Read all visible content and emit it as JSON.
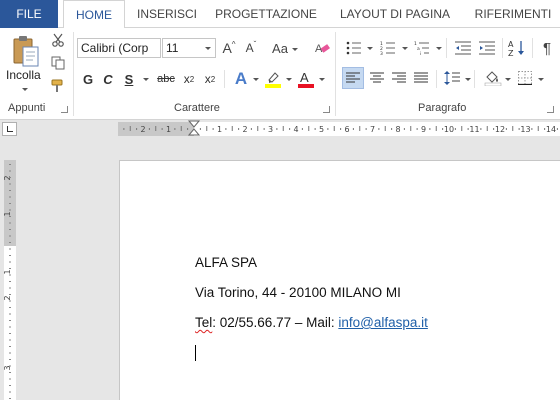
{
  "tabs": {
    "file": "FILE",
    "home": "HOME",
    "insert": "INSERISCI",
    "design": "PROGETTAZIONE",
    "layout": "LAYOUT DI PAGINA",
    "references": "RIFERIMENTI"
  },
  "ribbon": {
    "clipboard": {
      "paste_label": "Incolla",
      "group_label": "Appunti"
    },
    "font": {
      "font_name": "Calibri (Corp",
      "font_size": "11",
      "bold": "G",
      "italic": "C",
      "underline": "S",
      "strike": "abc",
      "subscript": "x",
      "subscript_index": "2",
      "superscript": "x",
      "superscript_index": "2",
      "grow": "A",
      "shrink": "A",
      "change_case": "Aa",
      "text_effects": "A",
      "font_color": "A",
      "group_label": "Carattere",
      "highlight_color": "#ffff00",
      "font_color_value": "#e81123"
    },
    "paragraph": {
      "group_label": "Paragrafo",
      "pilcrow": "¶"
    }
  },
  "ruler": {
    "labels": [
      "2",
      "1",
      "1",
      "2",
      "3",
      "4",
      "5",
      "6",
      "7",
      "8",
      "9",
      "10",
      "11",
      "12",
      "13",
      "14"
    ],
    "vlabels": [
      "2",
      "1",
      "1",
      "2",
      "3"
    ]
  },
  "document": {
    "line1": "ALFA SPA",
    "line2": "Via Torino, 44 - 20100 MILANO MI",
    "line3_tel": "Tel",
    "line3_rest": ": 02/55.66.77 – Mail: ",
    "line3_email": "info@alfaspa.it"
  },
  "colors": {
    "accent": "#2b579a",
    "link": "#1f5fa8"
  }
}
